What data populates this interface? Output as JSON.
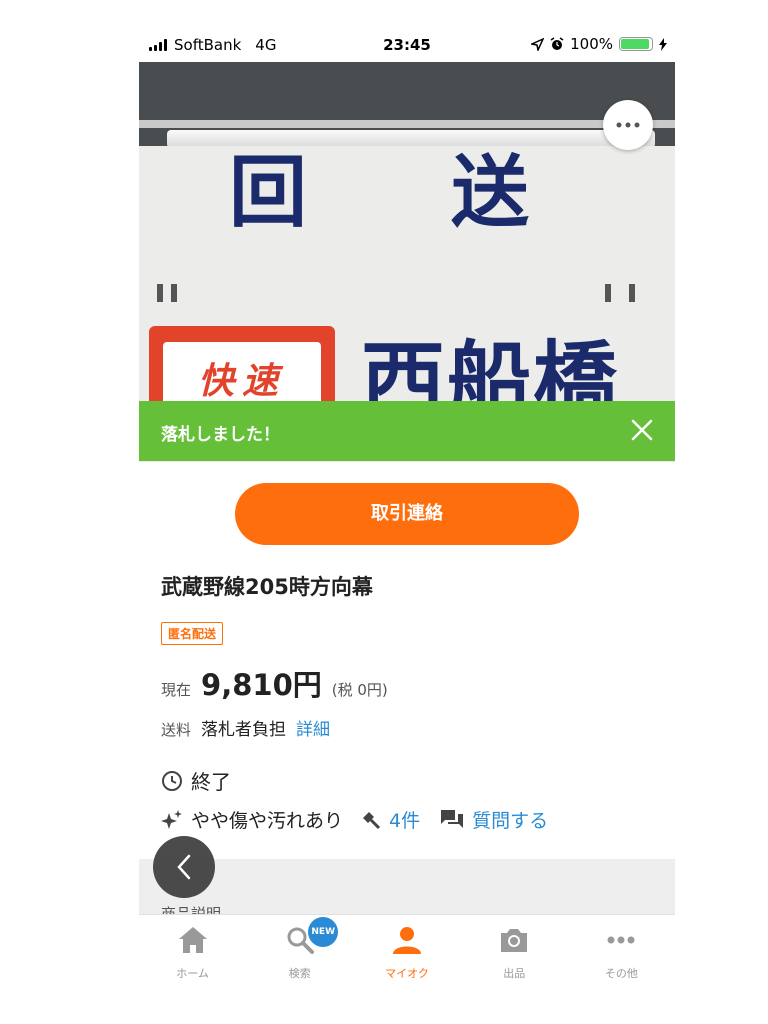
{
  "status_bar": {
    "carrier": "SoftBank",
    "network": "4G",
    "time": "23:45",
    "battery": "100%",
    "battery_level": 1.0
  },
  "photo": {
    "sign_top_text": [
      "回",
      "送"
    ],
    "rapid_label": "快速",
    "destination": "西船橋",
    "more_icon": "more-horizontal-icon"
  },
  "banner": {
    "message": "落札しました！",
    "color": "#65bf38"
  },
  "contact_button": {
    "label": "取引連絡",
    "color": "#ff6e0d"
  },
  "item": {
    "title": "武蔵野線205時方向幕",
    "badge": "匿名配送",
    "price_label": "現在",
    "price": "9,810円",
    "tax": "(税 0円)",
    "shipping_label": "送料",
    "shipping_value": "落札者負担",
    "shipping_link": "詳細",
    "status": "終了",
    "condition": "やや傷や汚れあり",
    "bids": "4件",
    "question_link": "質問する",
    "description_label": "商品説明"
  },
  "tabbar": {
    "items": [
      {
        "label": "ホーム",
        "icon": "home-icon"
      },
      {
        "label": "検索",
        "icon": "search-icon",
        "badge": "NEW"
      },
      {
        "label": "マイオク",
        "icon": "person-icon",
        "active": true
      },
      {
        "label": "出品",
        "icon": "camera-icon"
      },
      {
        "label": "その他",
        "icon": "more-icon"
      }
    ]
  },
  "colors": {
    "accent": "#ff6e0d",
    "link": "#2a8bd4",
    "success": "#65bf38"
  }
}
